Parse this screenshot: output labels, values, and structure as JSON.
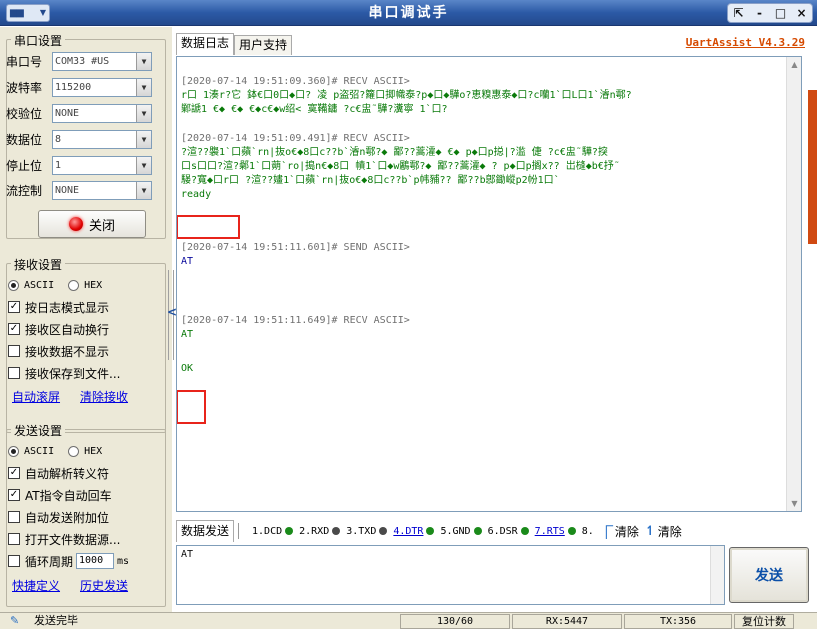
{
  "window": {
    "title": "串口调试手",
    "controls": [
      "⇱",
      "-",
      "□",
      "×"
    ]
  },
  "serial_settings": {
    "group_title": "串口设置",
    "port": {
      "label": "串口号",
      "value": "COM33 #US"
    },
    "baud": {
      "label": "波特率",
      "value": "115200"
    },
    "parity": {
      "label": "校验位",
      "value": "NONE"
    },
    "databits": {
      "label": "数据位",
      "value": "8"
    },
    "stopbits": {
      "label": "停止位",
      "value": "1"
    },
    "flow": {
      "label": "流控制",
      "value": "NONE"
    },
    "close_label": "关闭"
  },
  "receive_settings": {
    "group_title": "接收设置",
    "ascii": "ASCII",
    "hex": "HEX",
    "log_mode": "按日志模式显示",
    "auto_wrap": "接收区自动换行",
    "hide_rx": "接收数据不显示",
    "save_file": "接收保存到文件...",
    "auto_scroll": "自动滚屏",
    "clear_rx": "清除接收"
  },
  "send_settings": {
    "group_title": "发送设置",
    "ascii": "ASCII",
    "hex": "HEX",
    "auto_escape": "自动解析转义符",
    "at_cr": "AT指令自动回车",
    "auto_checksum": "自动发送附加位",
    "open_file": "打开文件数据源...",
    "cycle": "循环周期",
    "cycle_value": "1000",
    "cycle_unit": "ms",
    "shortcut": "快捷定义",
    "history": "历史发送"
  },
  "tabs": {
    "log": "数据日志",
    "support": "用户支持",
    "version": "UartAssist V4.3.29"
  },
  "log": [
    {
      "ts": "[2020-07-14 19:51:09.360]# RECV ASCII>",
      "lines": [
        "r口 1湊r?它 鉢€口0口◆口? 凌 p盗弨?籮口揤幟泰?p◆口◆驊o?恵糗惠泰◆口?c囒1`口L口1`濬n鄠?",
        "  鄛謕1  €◆  €◆  €◆c€◆w绍< 寞鞴鏞  ?c€盅˜驊?瀵寧 1`口?"
      ]
    },
    {
      "ts": "[2020-07-14 19:51:09.491]# RECV ASCII>",
      "lines": [
        "?渲??褜1`口蘋`rn|抜o€◆8口c??b`濬n鄠?◆  鄙??蒿瀖◆  €◆  p◆口p搃|?滥  倢  ?c€盅˜驊?揬",
        "口s口口?渲?鄵1`口蒴`ro|搗n€◆8口 幘1`口◆w鷵鄠?◆  鄙??蒿瀖◆  ?  p◆口p搁x??  岀槰◆b€抒˜",
        "騴?寬◆口r口 ?渲??嫿1`口蘋`rn|抜o€◆8口c??b`p帏豧??  鄙??b鄎鋤嵷p2帉1口`"
      ],
      "tail": "ready"
    },
    {
      "ts": "[2020-07-14 19:51:11.601]# SEND ASCII>",
      "lines": [
        "AT"
      ]
    },
    {
      "ts": "[2020-07-14 19:51:11.649]# RECV ASCII>",
      "lines": [
        "AT"
      ],
      "tail": "OK"
    }
  ],
  "send_panel": {
    "tab": "数据发送",
    "pins": [
      {
        "label": "1.DCD",
        "color": "#1a8a1a",
        "link": false
      },
      {
        "label": "2.RXD",
        "color": "#4a4a4a",
        "link": false
      },
      {
        "label": "3.TXD",
        "color": "#4a4a4a",
        "link": false
      },
      {
        "label": "4.DTR",
        "color": "#1a8a1a",
        "link": true
      },
      {
        "label": "5.GND",
        "color": "#1a8a1a",
        "link": false
      },
      {
        "label": "6.DSR",
        "color": "#1a8a1a",
        "link": false
      },
      {
        "label": "7.RTS",
        "color": "#1a8a1a",
        "link": true
      },
      {
        "label": "8.",
        "color": "#1a8a1a",
        "link": false
      }
    ],
    "clear1": "清除",
    "clear2": "清除",
    "input_value": "AT",
    "send_label": "发送"
  },
  "status": {
    "message": "发送完毕",
    "count": "130/60",
    "rx": "RX:5447",
    "tx": "TX:356",
    "reset": "复位计数"
  }
}
